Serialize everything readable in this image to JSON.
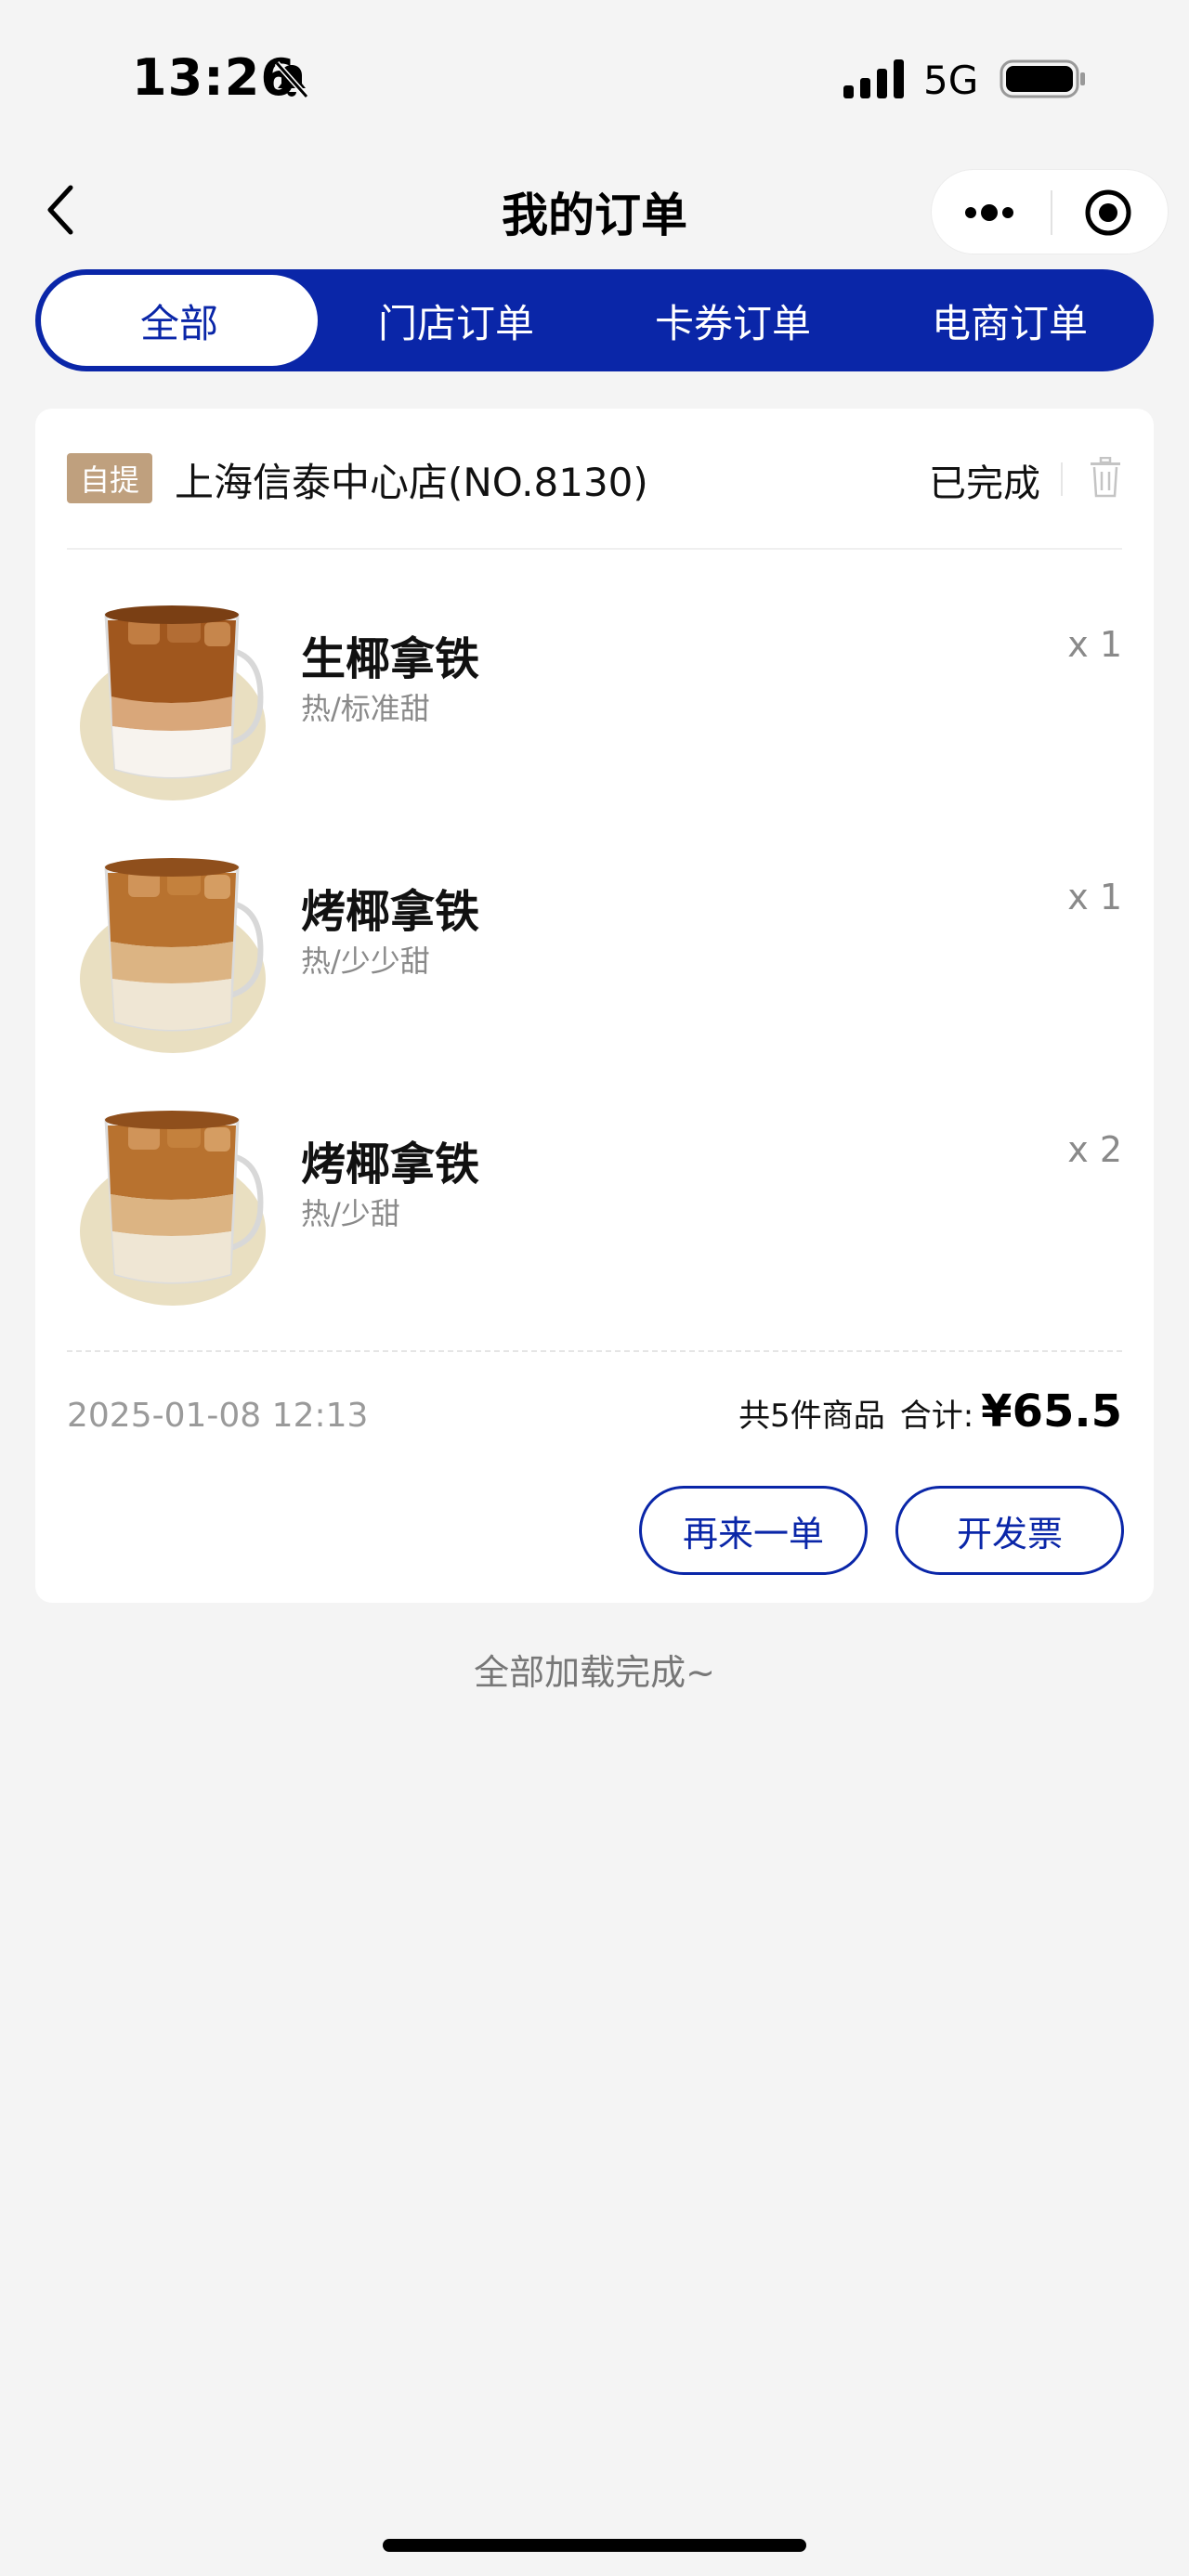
{
  "status_bar": {
    "time": "13:26",
    "network": "5G"
  },
  "nav": {
    "title": "我的订单"
  },
  "tabs": [
    {
      "label": "全部",
      "active": true
    },
    {
      "label": "门店订单",
      "active": false
    },
    {
      "label": "卡券订单",
      "active": false
    },
    {
      "label": "电商订单",
      "active": false
    }
  ],
  "order": {
    "pickup_badge": "自提",
    "store_name": "上海信泰中心店(NO.8130)",
    "status": "已完成",
    "items": [
      {
        "name": "生椰拿铁",
        "spec": "热/标准甜",
        "qty": "x 1"
      },
      {
        "name": "烤椰拿铁",
        "spec": "热/少少甜",
        "qty": "x 1"
      },
      {
        "name": "烤椰拿铁",
        "spec": "热/少甜",
        "qty": "x 2"
      }
    ],
    "time": "2025-01-08 12:13",
    "count_text": "共5件商品",
    "total_label": "合计:",
    "total_value": "¥65.5",
    "reorder_label": "再来一单",
    "invoice_label": "开发票"
  },
  "footer": {
    "load_done": "全部加载完成~"
  },
  "colors": {
    "brand": "#0a26a8",
    "badge": "#bfa07e",
    "background": "#f4f4f4"
  }
}
